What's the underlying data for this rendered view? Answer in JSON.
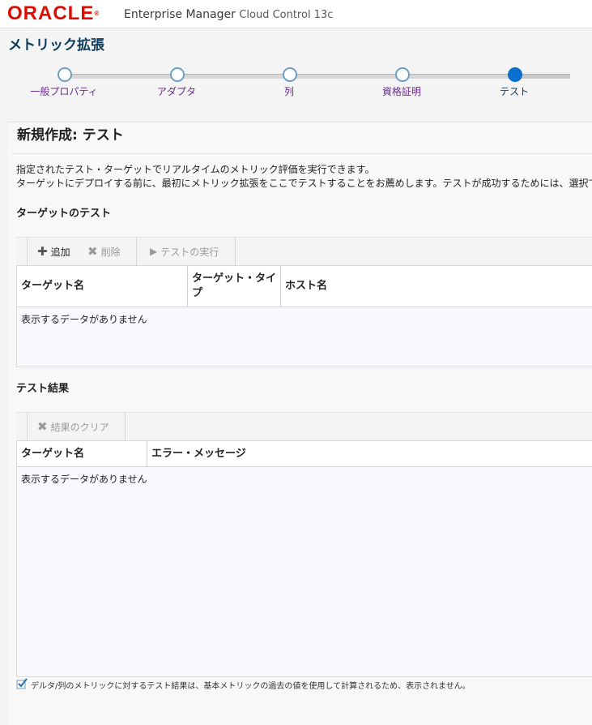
{
  "header": {
    "logo_text": "ORACLE",
    "logo_mark": "®",
    "product_main": "Enterprise Manager",
    "product_light": "Cloud Control 13c"
  },
  "page": {
    "title": "メトリック拡張"
  },
  "train": {
    "steps": [
      {
        "label": "一般プロパティ"
      },
      {
        "label": "アダプタ"
      },
      {
        "label": "列"
      },
      {
        "label": "資格証明"
      },
      {
        "label": "テスト"
      }
    ],
    "current_index": 4
  },
  "content": {
    "subtitle": "新規作成: テスト",
    "description_line1": "指定されたテスト・ターゲットでリアルタイムのメトリック評価を実行できます。",
    "description_line2": "ターゲットにデプロイする前に、最初にメトリック拡張をここでテストすることをお薦めします。テストが成功するためには、選択で"
  },
  "target_test": {
    "section_title": "ターゲットのテスト",
    "toolbar": {
      "add_label": "追加",
      "remove_label": "削除",
      "run_label": "テストの実行"
    },
    "columns": [
      "ターゲット名",
      "ターゲット・タイプ",
      "ホスト名"
    ],
    "empty_text": "表示するデータがありません"
  },
  "test_results": {
    "section_title": "テスト結果",
    "toolbar": {
      "clear_label": "結果のクリア"
    },
    "columns": [
      "ターゲット名",
      "エラー・メッセージ"
    ],
    "empty_text": "表示するデータがありません"
  },
  "footnote": {
    "text": "デルタ/列のメトリックに対するテスト結果は、基本メトリックの過去の値を使用して計算されるため、表示されません。"
  },
  "colors": {
    "oracle_red": "#e00b00",
    "title_blue": "#0b3a5a",
    "step_current": "#0a6fcf",
    "step_label": "#6a2a8a"
  }
}
